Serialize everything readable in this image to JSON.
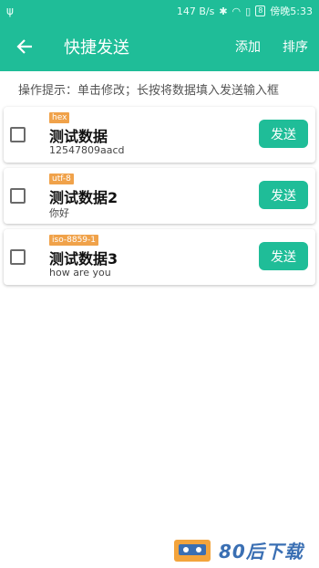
{
  "status_bar": {
    "usb_icon": "usb-icon",
    "speed": "147 B/s",
    "battery": "8",
    "carrier_time": "傍晚5:33"
  },
  "toolbar": {
    "title": "快捷发送",
    "add_label": "添加",
    "sort_label": "排序",
    "background": "#1fbd98"
  },
  "hint": "操作提示：单击修改；长按将数据填入发送输入框",
  "items": [
    {
      "tag": "hex",
      "name": "测试数据",
      "value": "12547809aacd",
      "send_label": "发送"
    },
    {
      "tag": "utf-8",
      "name": "测试数据2",
      "value": "你好",
      "send_label": "发送"
    },
    {
      "tag": "iso-8859-1",
      "name": "测试数据3",
      "value": "how are you",
      "send_label": "发送"
    }
  ],
  "watermark": {
    "text": "80后下载"
  }
}
